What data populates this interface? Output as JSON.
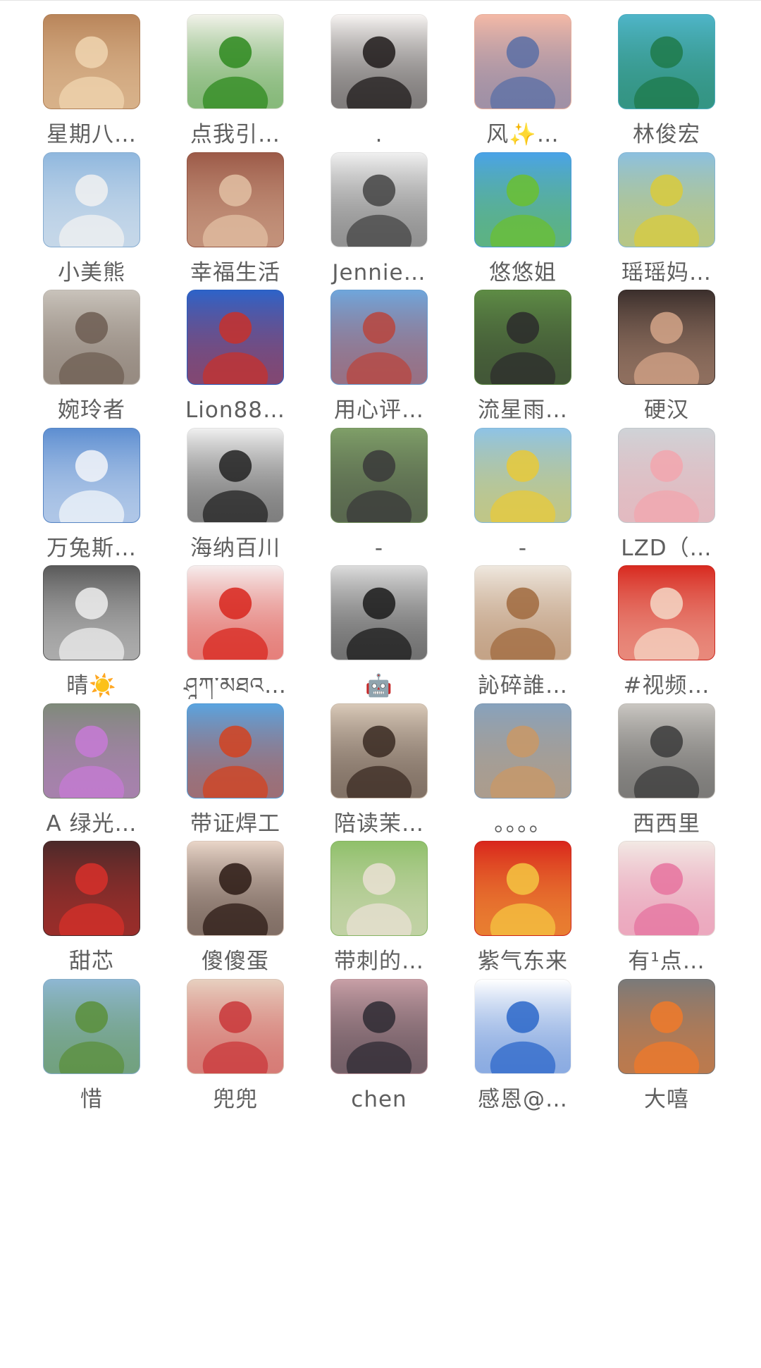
{
  "members": [
    {
      "name": "星期八…",
      "avatar": {
        "icon": "corgi-dog-photo",
        "bg": "#b9855a",
        "fg": "#f0d5b0"
      }
    },
    {
      "name": "点我引…",
      "avatar": {
        "icon": "green-coins-photo",
        "bg": "#f2f2ea",
        "fg": "#2e8a1e"
      }
    },
    {
      "name": ".",
      "avatar": {
        "icon": "anime-girl-drawing",
        "bg": "#f7f4f2",
        "fg": "#1e1a1a"
      }
    },
    {
      "name": "风✨…",
      "avatar": {
        "icon": "children-sunset-drawing",
        "bg": "#f4b9a6",
        "fg": "#5a6fa5"
      }
    },
    {
      "name": "林俊宏",
      "avatar": {
        "icon": "dragon-painting",
        "bg": "#4fb5c9",
        "fg": "#1e7a4a"
      }
    },
    {
      "name": "小美熊",
      "avatar": {
        "icon": "seal-pup-photo",
        "bg": "#8fb7de",
        "fg": "#f1f1f1"
      }
    },
    {
      "name": "幸福生活",
      "avatar": {
        "icon": "boy-selfie-photo",
        "bg": "#9c5a48",
        "fg": "#e2bfa3"
      }
    },
    {
      "name": "Jennie…",
      "avatar": {
        "icon": "line-cat-drawing",
        "bg": "#f0f0f0",
        "fg": "#444444"
      }
    },
    {
      "name": "悠悠姐",
      "avatar": {
        "icon": "green-field-sky",
        "bg": "#4aa3e8",
        "fg": "#6bbf30"
      }
    },
    {
      "name": "瑶瑶妈…",
      "avatar": {
        "icon": "girl-flower-field-photo",
        "bg": "#8cc0e0",
        "fg": "#d9cb3c"
      }
    },
    {
      "name": "婉玲者",
      "avatar": {
        "icon": "portrait-circle-frame",
        "bg": "#c9c3bb",
        "fg": "#6d5d52"
      }
    },
    {
      "name": "Lion88…",
      "avatar": {
        "icon": "potala-palace-photo",
        "bg": "#2d63c9",
        "fg": "#c7312c"
      }
    },
    {
      "name": "用心评…",
      "avatar": {
        "icon": "stone-monument-photo",
        "bg": "#6fa6dc",
        "fg": "#b9453d"
      }
    },
    {
      "name": "流星雨…",
      "avatar": {
        "icon": "woman-garden-photo",
        "bg": "#5e8c45",
        "fg": "#2c2c2c"
      }
    },
    {
      "name": "硬汉",
      "avatar": {
        "icon": "tattooed-man-photo",
        "bg": "#3b2f2c",
        "fg": "#d4a488"
      }
    },
    {
      "name": "万兔斯…",
      "avatar": {
        "icon": "cloud-sky-photo",
        "bg": "#5d8ed1",
        "fg": "#f2f5f9"
      }
    },
    {
      "name": "海纳百川",
      "avatar": {
        "icon": "man-suit-photo",
        "bg": "#f0f0f0",
        "fg": "#222222"
      }
    },
    {
      "name": "-",
      "avatar": {
        "icon": "woman-path-photo",
        "bg": "#7f9f68",
        "fg": "#3a3a3a"
      }
    },
    {
      "name": "-",
      "avatar": {
        "icon": "cartoon-boy-raincoat",
        "bg": "#8ec3e6",
        "fg": "#e8c93a"
      }
    },
    {
      "name": "LZD（…",
      "avatar": {
        "icon": "cat-photo",
        "bg": "#cfd3d7",
        "fg": "#f2a6ae"
      }
    },
    {
      "name": "晴☀️",
      "avatar": {
        "icon": "bracelet-photo",
        "bg": "#5a5a5a",
        "fg": "#eeeeee"
      }
    },
    {
      "name": "ཤཱཀ་མཐའ…",
      "avatar": {
        "icon": "china-flag-calligraphy",
        "bg": "#f6eded",
        "fg": "#d8261d"
      }
    },
    {
      "name": "🤖",
      "avatar": {
        "icon": "sleeping-sirens-stickers",
        "bg": "#dcdcdc",
        "fg": "#1a1a1a"
      }
    },
    {
      "name": "訫碎誰…",
      "avatar": {
        "icon": "shelf-cabinet-photo",
        "bg": "#efe8df",
        "fg": "#a06a3e"
      }
    },
    {
      "name": "#视频…",
      "avatar": {
        "icon": "children-flag-photo",
        "bg": "#d82a20",
        "fg": "#f5d7c6"
      }
    },
    {
      "name": "A 绿光…",
      "avatar": {
        "icon": "child-icecream-photo",
        "bg": "#7f8a7a",
        "fg": "#c77ad6"
      }
    },
    {
      "name": "带证焊工",
      "avatar": {
        "icon": "red-sculpture-photo",
        "bg": "#5aa4e0",
        "fg": "#d4421e"
      }
    },
    {
      "name": "陪读茉…",
      "avatar": {
        "icon": "woman-glasses-selfie",
        "bg": "#d9c9b8",
        "fg": "#3a2a22"
      }
    },
    {
      "name": "。。。。",
      "avatar": {
        "icon": "woman-sunset-sea-photo",
        "bg": "#87a2bd",
        "fg": "#c99866"
      }
    },
    {
      "name": "西西里",
      "avatar": {
        "icon": "room-interior-photo",
        "bg": "#cac7c2",
        "fg": "#3b3b3b"
      }
    },
    {
      "name": "甜芯",
      "avatar": {
        "icon": "fireworks-woman-drawing",
        "bg": "#4b2a2a",
        "fg": "#d7302a"
      }
    },
    {
      "name": "傻傻蛋",
      "avatar": {
        "icon": "crying-toddler-photo",
        "bg": "#e9d5c8",
        "fg": "#2b1a14"
      }
    },
    {
      "name": "带刺的…",
      "avatar": {
        "icon": "woman-sunglasses-photo",
        "bg": "#8fc06a",
        "fg": "#eae0d4"
      }
    },
    {
      "name": "紫气东来",
      "avatar": {
        "icon": "red-fortune-calligraphy",
        "bg": "#d9261c",
        "fg": "#f5c542"
      }
    },
    {
      "name": "有¹点…",
      "avatar": {
        "icon": "cartoon-girl-heart-glasses",
        "bg": "#f2e9e4",
        "fg": "#e6739f"
      }
    },
    {
      "name": "惜",
      "avatar": {
        "icon": "mountain-lake-photo",
        "bg": "#8eb7d3",
        "fg": "#5b8f3b"
      }
    },
    {
      "name": "兜兜",
      "avatar": {
        "icon": "child-festive-photo",
        "bg": "#e7d0c0",
        "fg": "#c9373a"
      }
    },
    {
      "name": "chen",
      "avatar": {
        "icon": "silhouette-sunset-photo",
        "bg": "#c89fa6",
        "fg": "#2e2a33"
      }
    },
    {
      "name": "感恩@…",
      "avatar": {
        "icon": "blue-heart-hands",
        "bg": "#ffffff",
        "fg": "#2c67c9"
      }
    },
    {
      "name": "大嘻",
      "avatar": {
        "icon": "cartoon-orange-hair-girl",
        "bg": "#7a7a7a",
        "fg": "#f07a2a"
      }
    }
  ]
}
